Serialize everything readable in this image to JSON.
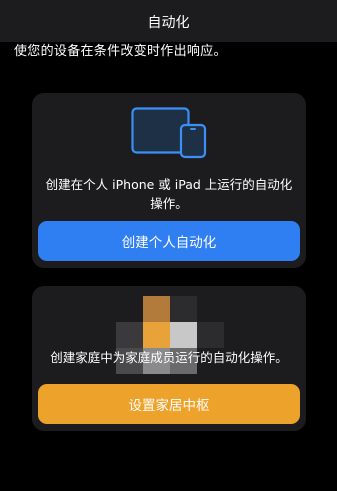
{
  "nav": {
    "title": "自动化"
  },
  "subtitle": "使您的设备在条件改变时作出响应。",
  "personal_card": {
    "description": "创建在个人 iPhone 或 iPad 上运行的自动化操作。",
    "button_label": "创建个人自动化",
    "icon": "iphone-ipad-icon",
    "button_color": "#2f7ff2"
  },
  "home_card": {
    "description": "创建家庭中为家庭成员运行的自动化操作。",
    "button_label": "设置家居中枢",
    "icon": "pixelated-home-hub-image",
    "button_color": "#eda22b"
  }
}
